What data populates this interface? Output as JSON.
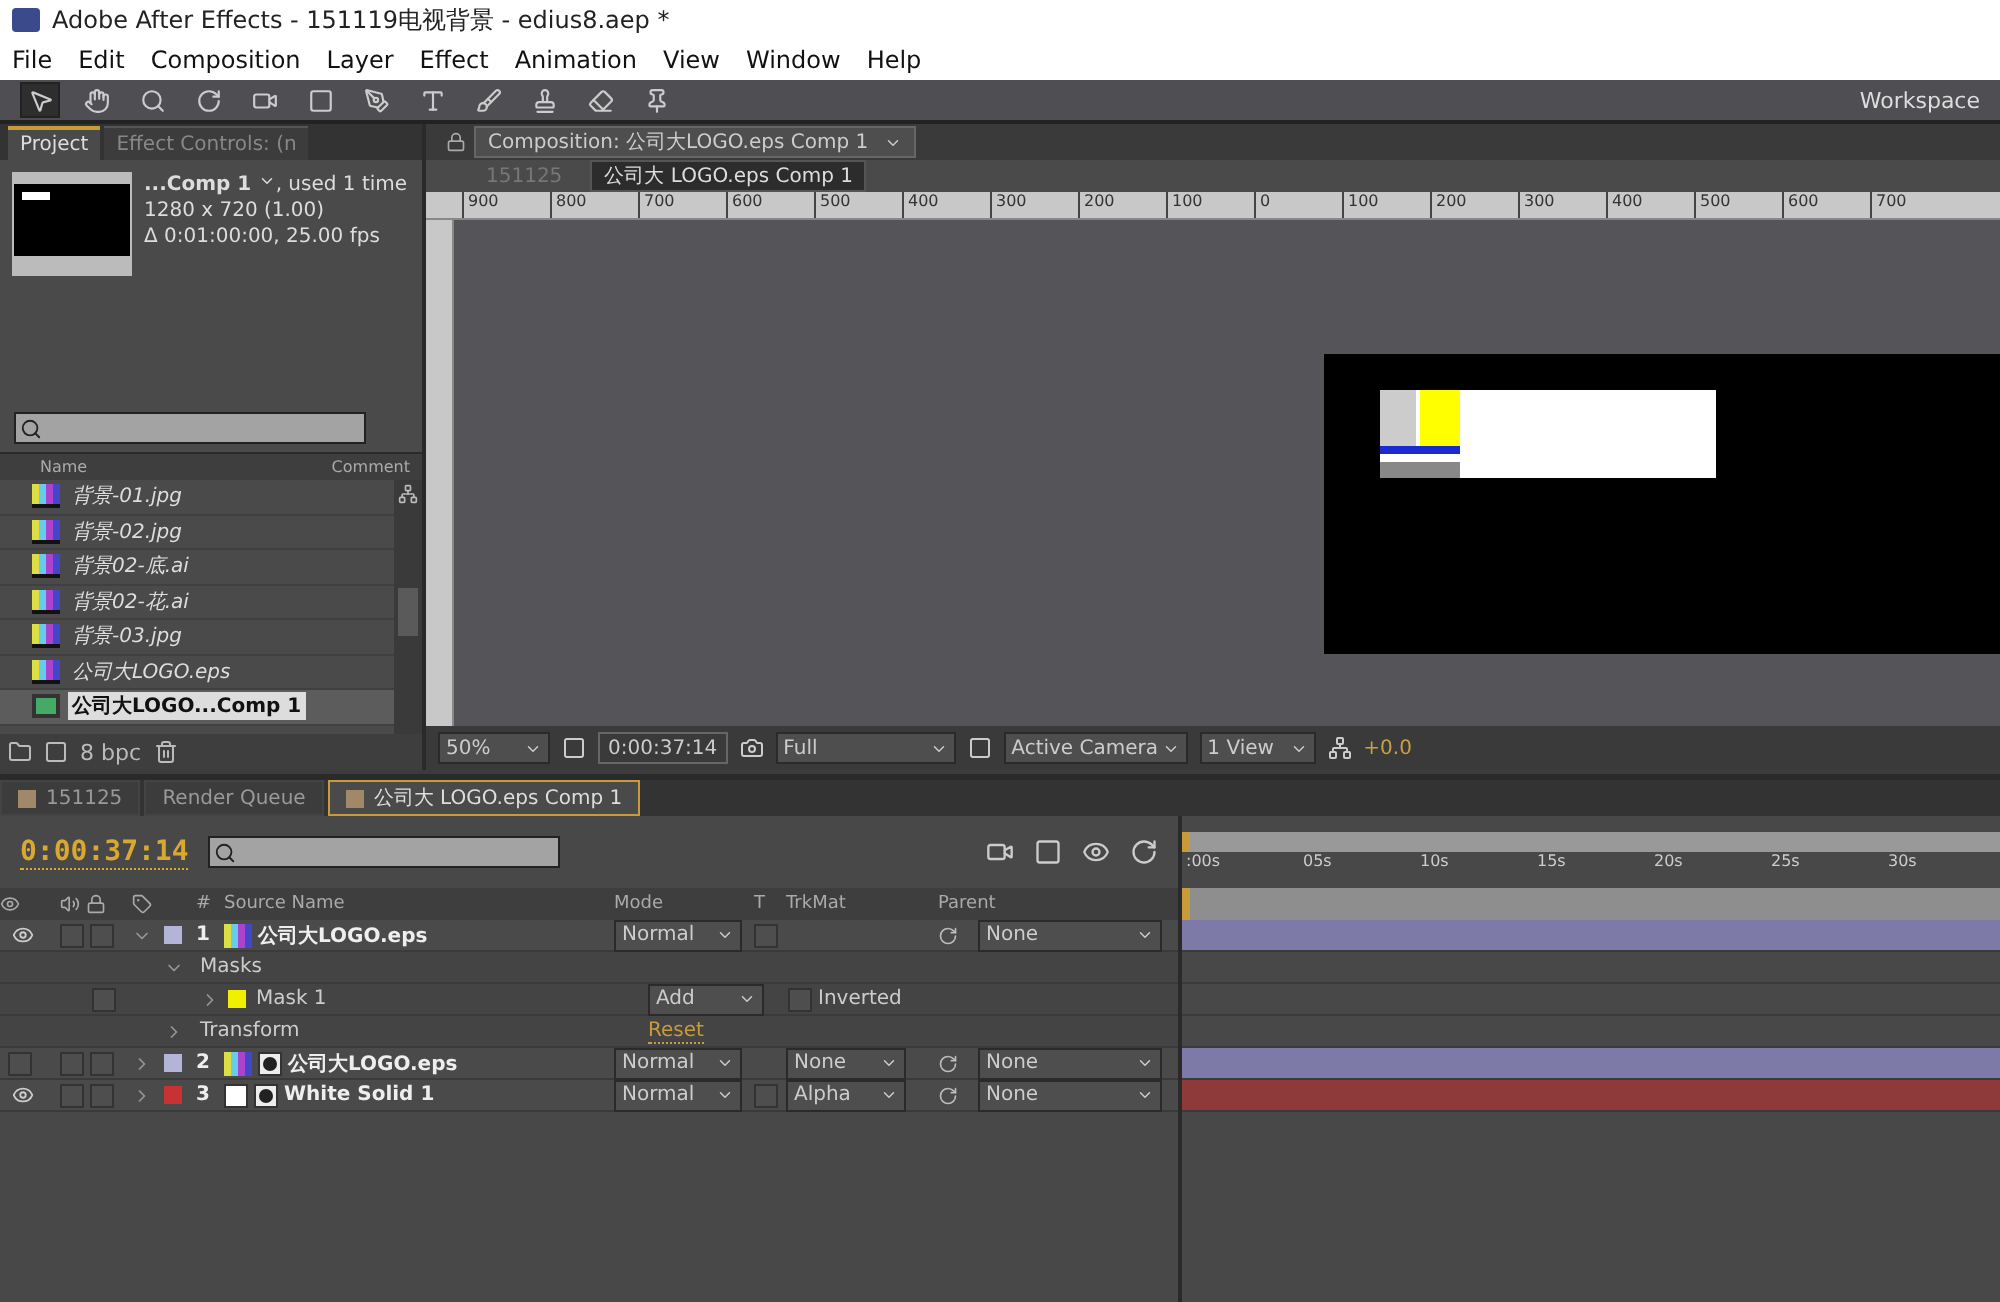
{
  "window": {
    "title": "Adobe After Effects - 151119电视背景 - edius8.aep *"
  },
  "menu": [
    "File",
    "Edit",
    "Composition",
    "Layer",
    "Effect",
    "Animation",
    "View",
    "Window",
    "Help"
  ],
  "workspace": "Workspace",
  "project_panel": {
    "tabs": [
      {
        "label": "Project",
        "selected": true
      },
      {
        "label": "Effect Controls: (n",
        "selected": false
      }
    ],
    "info": {
      "name": "...Comp 1",
      "used": ", used 1 time",
      "size": "1280 x 720 (1.00)",
      "duration": "Δ 0:01:00:00, 25.00 fps"
    },
    "columns": [
      "Name",
      "Comment"
    ],
    "items": [
      {
        "name": "背景-01.jpg",
        "kind": "footage",
        "selected": false
      },
      {
        "name": "背景-02.jpg",
        "kind": "footage",
        "selected": false
      },
      {
        "name": "背景02-底.ai",
        "kind": "footage",
        "selected": false
      },
      {
        "name": "背景02-花.ai",
        "kind": "footage",
        "selected": false
      },
      {
        "name": "背景-03.jpg",
        "kind": "footage",
        "selected": false
      },
      {
        "name": "公司大LOGO.eps",
        "kind": "footage",
        "selected": false
      },
      {
        "name": "公司大LOGO...Comp 1",
        "kind": "comp",
        "selected": true
      }
    ],
    "bpc": "8 bpc"
  },
  "composition_panel": {
    "tab": "Composition: 公司大LOGO.eps Comp 1",
    "breadcrumbs": [
      {
        "label": "151125",
        "selected": false
      },
      {
        "label": "公司大 LOGO.eps Comp 1",
        "selected": true
      }
    ],
    "ruler": [
      "900",
      "800",
      "700",
      "600",
      "500",
      "400",
      "300",
      "200",
      "100",
      "0",
      "100",
      "200",
      "300",
      "400",
      "500",
      "600",
      "700"
    ],
    "zoom": "50%",
    "timecode": "0:00:37:14",
    "resolution": "Full",
    "camera": "Active Camera",
    "views": "1 View",
    "exposure": "+0.0"
  },
  "timeline": {
    "tabs": [
      {
        "label": "151125",
        "selected": false
      },
      {
        "label": "Render Queue",
        "selected": false
      },
      {
        "label": "公司大 LOGO.eps Comp 1",
        "selected": true
      }
    ],
    "timecode": "0:00:37:14",
    "columns": [
      "#",
      "Source Name",
      "Mode",
      "T",
      "TrkMat",
      "Parent"
    ],
    "ruler": [
      ":00s",
      "05s",
      "10s",
      "15s",
      "20s",
      "25s",
      "30s"
    ],
    "rows": [
      {
        "kind": "footage_layer",
        "visible": true,
        "expanded": true,
        "color": "#b4b4d8",
        "number": "1",
        "name": "公司大LOGO.eps",
        "mode": "Normal",
        "preserve_transparency": false,
        "parent": "None",
        "has_mask": false
      },
      {
        "kind": "group",
        "name": "Masks"
      },
      {
        "kind": "mask",
        "color": "#f0f000",
        "name": "Mask 1",
        "mode": "Add",
        "option": "Inverted",
        "inverted": false
      },
      {
        "kind": "property",
        "name": "Transform",
        "value": "Reset"
      },
      {
        "kind": "footage_layer",
        "visible": false,
        "expanded": false,
        "color": "#b4b4d8",
        "number": "2",
        "name": "公司大LOGO.eps",
        "mode": "Normal",
        "trkmat": "None",
        "parent": "None",
        "has_mask": true
      },
      {
        "kind": "solid_layer",
        "visible": true,
        "expanded": false,
        "color": "#c83232",
        "number": "3",
        "name": "White Solid 1",
        "mode": "Normal",
        "preserve_transparency": false,
        "trkmat": "Alpha",
        "parent": "None",
        "has_mask": true
      }
    ]
  }
}
